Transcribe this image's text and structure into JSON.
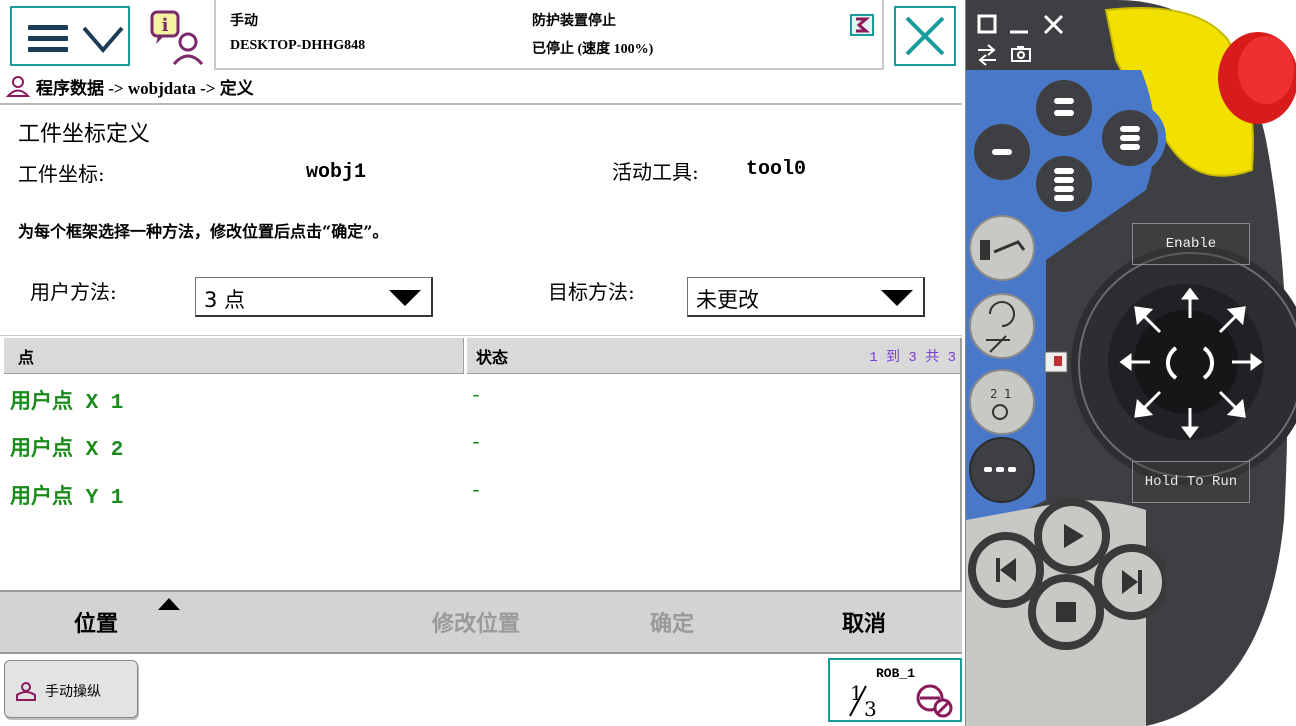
{
  "status": {
    "mode": "手动",
    "system_name": "DESKTOP-DHHG848",
    "safety_state": "防护装置停止",
    "run_state": "已停止 (速度 100%)"
  },
  "breadcrumb": "程序数据 -> wobjdata -> 定义",
  "page": {
    "title": "工件坐标定义",
    "workobject_label": "工件坐标:",
    "workobject_value": "wobj1",
    "active_tool_label": "活动工具:",
    "active_tool_value": "tool0",
    "instruction": "为每个框架选择一种方法，修改位置后点击“确定”。",
    "user_method_label": "用户方法:",
    "user_method_value": "3 点",
    "target_method_label": "目标方法:",
    "target_method_value": "未更改"
  },
  "table": {
    "headers": [
      "点",
      "状态"
    ],
    "count_text": "1 到 3 共 3",
    "rows": [
      {
        "point": "用户点 X 1",
        "status": "-"
      },
      {
        "point": "用户点 X 2",
        "status": "-"
      },
      {
        "point": "用户点 Y 1",
        "status": "-"
      }
    ]
  },
  "commands": {
    "position": "位置",
    "modify_position": "修改位置",
    "ok": "确定",
    "cancel": "取消"
  },
  "taskbar": {
    "jog_label": "手动操纵",
    "robot_name": "ROB_1"
  },
  "pendant": {
    "enable_label": "Enable",
    "hold_label": "Hold To Run"
  },
  "colors": {
    "accent_teal": "#159c9c",
    "point_green": "#1a8a1a",
    "count_purple": "#7a3fd4",
    "pendant_blue": "#4a78c8",
    "pendant_yellow": "#f2e000",
    "emergency_red": "#d81c1c"
  }
}
